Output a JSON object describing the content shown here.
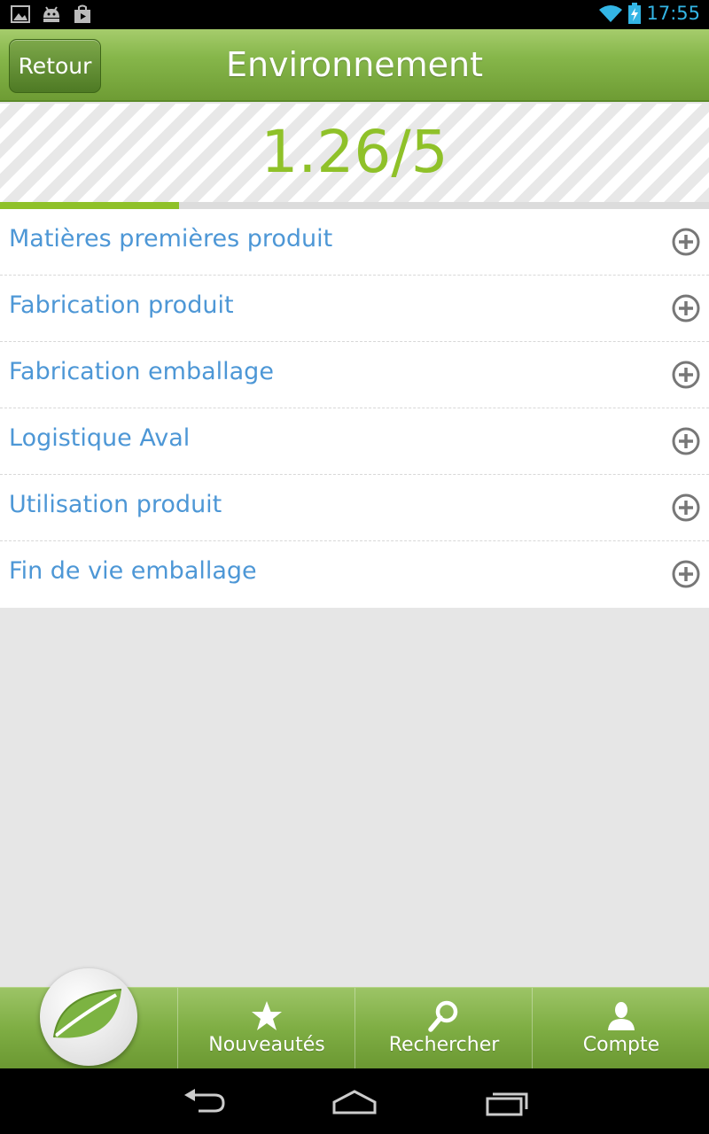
{
  "status_bar": {
    "time": "17:55",
    "icons": [
      "gallery-icon",
      "android-icon",
      "play-store-icon",
      "wifi-icon",
      "battery-charging-icon"
    ],
    "time_color": "#33b5e5"
  },
  "header": {
    "back_label": "Retour",
    "title": "Environnement"
  },
  "score": {
    "text": "1.26/5",
    "value": 1.26,
    "max": 5,
    "color": "#8fc129"
  },
  "items": [
    {
      "label": "Matières premières produit",
      "icon": "plus-circle-icon"
    },
    {
      "label": "Fabrication produit",
      "icon": "plus-circle-icon"
    },
    {
      "label": "Fabrication emballage",
      "icon": "plus-circle-icon"
    },
    {
      "label": "Logistique Aval",
      "icon": "plus-circle-icon"
    },
    {
      "label": "Utilisation produit",
      "icon": "plus-circle-icon"
    },
    {
      "label": "Fin de vie emballage",
      "icon": "plus-circle-icon"
    }
  ],
  "tabs": {
    "home_icon": "leaf-icon",
    "items": [
      {
        "label": "Nouveautés",
        "icon": "star-icon"
      },
      {
        "label": "Rechercher",
        "icon": "search-icon"
      },
      {
        "label": "Compte",
        "icon": "user-icon"
      }
    ]
  },
  "nav_bar": {
    "icons": [
      "back-icon",
      "home-icon",
      "recent-apps-icon"
    ]
  },
  "colors": {
    "accent_green": "#8fc129",
    "item_text_blue": "#4d97d6",
    "header_green": "#7cae44"
  }
}
